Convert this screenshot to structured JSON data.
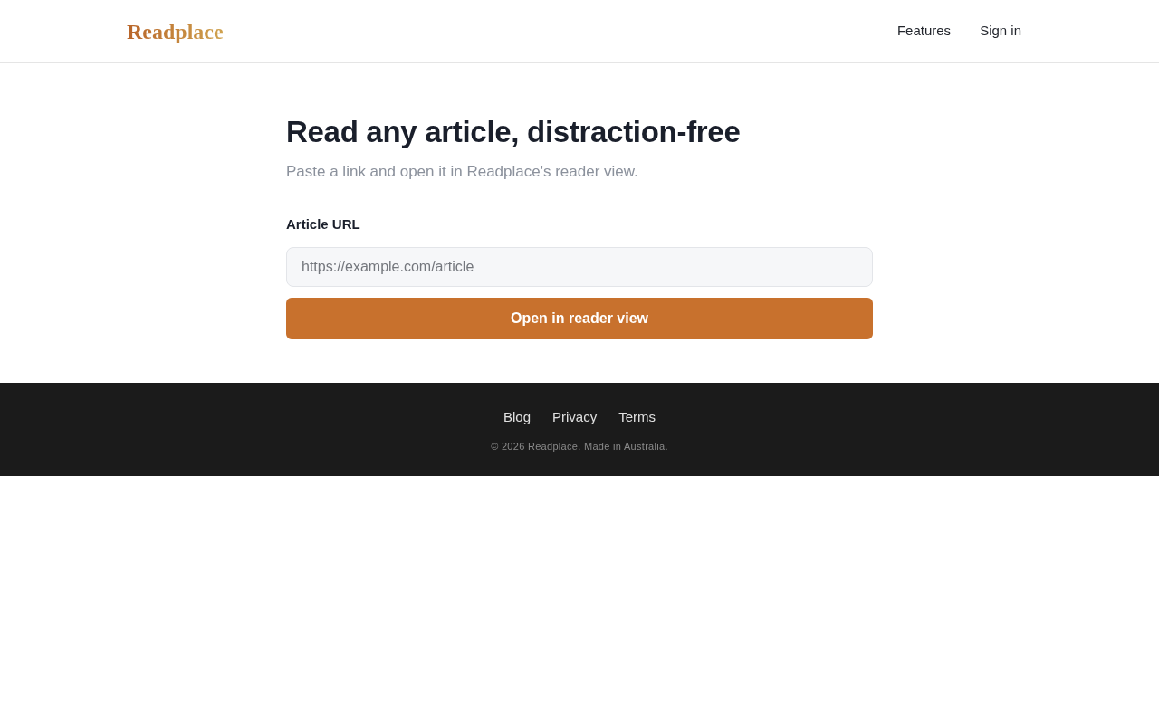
{
  "header": {
    "logo": "Readplace",
    "nav": [
      "Features",
      "Sign in"
    ]
  },
  "main": {
    "title": "Read any article, distraction-free",
    "subtitle": "Paste a link and open it in Readplace's reader view.",
    "field": {
      "label": "Article URL",
      "placeholder": "https://example.com/article"
    },
    "button": "Open in reader view"
  },
  "footer": {
    "links": [
      "Blog",
      "Privacy",
      "Terms"
    ],
    "copyright": "© 2026 Readplace. Made in Australia."
  }
}
